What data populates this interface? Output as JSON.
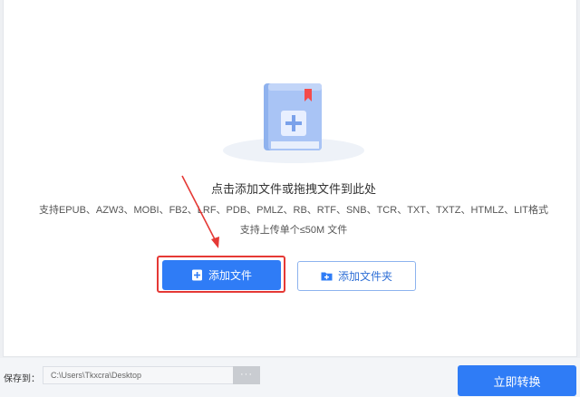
{
  "drop_area": {
    "prompt": "点击添加文件或拖拽文件到此处",
    "supported_formats": "支持EPUB、AZW3、MOBI、FB2、LRF、PDB、PMLZ、RB、RTF、SNB、TCR、TXT、TXTZ、HTMLZ、LIT格式",
    "size_limit": "支持上传单个≤50M 文件"
  },
  "buttons": {
    "add_file": "添加文件",
    "add_folder": "添加文件夹"
  },
  "footer": {
    "save_label": "保存到：",
    "save_path": "C:\\Users\\Tkxcra\\Desktop",
    "browse": "···",
    "convert": "立即转换"
  },
  "colors": {
    "accent": "#2f7cf6",
    "highlight": "#e53935"
  }
}
